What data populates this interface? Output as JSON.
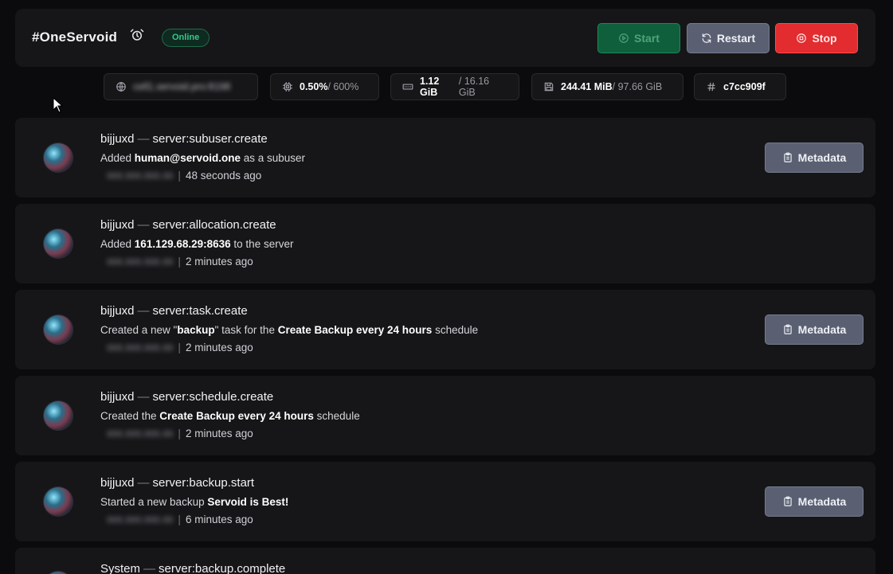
{
  "header": {
    "server_name": "#OneServoid",
    "status": "Online",
    "buttons": {
      "start": "Start",
      "restart": "Restart",
      "stop": "Stop"
    },
    "colors": {
      "online": "#35c98a",
      "start": "#0f5f3c",
      "restart": "#5a6072",
      "stop": "#e22c2f"
    }
  },
  "stats": {
    "address": "cell1.servoid.pro:8198",
    "cpu_used": "0.50%",
    "cpu_max": "/ 600%",
    "memory_used": "1.12 GiB",
    "memory_max": "/ 16.16 GiB",
    "disk_used": "244.41 MiB",
    "disk_max": "/ 97.66 GiB",
    "server_id": "c7cc909f"
  },
  "activity": [
    {
      "user": "bijjuxd",
      "sep": "—",
      "event": "server:subuser.create",
      "desc_pre": "Added ",
      "desc_bold": "human@servoid.one",
      "desc_post": " as a subuser",
      "ip": "000.000.000.00",
      "time": "48 seconds ago",
      "metadata_label": "Metadata"
    },
    {
      "user": "bijjuxd",
      "sep": "—",
      "event": "server:allocation.create",
      "desc_pre": "Added ",
      "desc_bold": "161.129.68.29:8636",
      "desc_post": " to the server",
      "ip": "000.000.000.00",
      "time": "2 minutes ago"
    },
    {
      "user": "bijjuxd",
      "sep": "—",
      "event": "server:task.create",
      "desc_pre": "Created a new \"",
      "desc_bold": "backup",
      "desc_mid": "\" task for the ",
      "desc_bold2": "Create Backup every 24 hours",
      "desc_post": " schedule",
      "ip": "000.000.000.00",
      "time": "2 minutes ago",
      "metadata_label": "Metadata"
    },
    {
      "user": "bijjuxd",
      "sep": "—",
      "event": "server:schedule.create",
      "desc_pre": "Created the ",
      "desc_bold": "Create Backup every 24 hours",
      "desc_post": " schedule",
      "ip": "000.000.000.00",
      "time": "2 minutes ago"
    },
    {
      "user": "bijjuxd",
      "sep": "—",
      "event": "server:backup.start",
      "desc_pre": "Started a new backup ",
      "desc_bold": "Servoid is Best!",
      "desc_post": "",
      "ip": "000.000.000.00",
      "time": "6 minutes ago",
      "metadata_label": "Metadata"
    },
    {
      "user": "System",
      "sep": "—",
      "event": "server:backup.complete"
    }
  ]
}
